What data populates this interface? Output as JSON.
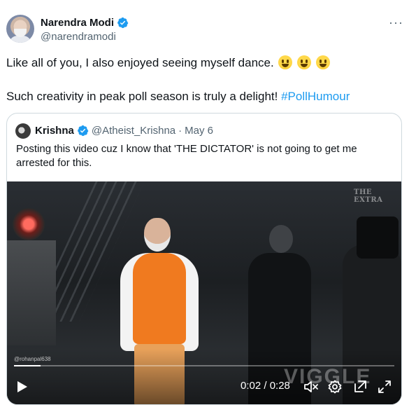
{
  "author": {
    "display_name": "Narendra Modi",
    "handle": "@narendramodi",
    "verified_color": "#1d9bf0"
  },
  "more_label": "···",
  "body": {
    "line1": "Like all of you, I also enjoyed seeing myself dance.",
    "line2_text": "Such creativity in peak poll season is truly a delight! ",
    "hashtag": "#PollHumour",
    "emoji_count": 3
  },
  "quote": {
    "name": "Krishna",
    "handle": "@Atheist_Krishna",
    "separator": "·",
    "date": "May 6",
    "text": "Posting this video cuz I know that 'THE DICTATOR' is not going to get me arrested for this."
  },
  "video": {
    "watermark_top": "THE EXTRA",
    "watermark_credit": "@rohanpal638",
    "watermark_big": "VIGGLE",
    "time_display": "0:02 / 0:28",
    "progress_fraction": 0.07
  },
  "icons": {
    "verified": "verified-badge-icon",
    "play": "play-icon",
    "mute": "muted-speaker-icon",
    "settings": "gear-icon",
    "popout": "popout-icon",
    "fullscreen": "fullscreen-icon"
  },
  "colors": {
    "text": "#0f1419",
    "secondary": "#536471",
    "link": "#1d9bf0",
    "border": "#cfd9de"
  }
}
